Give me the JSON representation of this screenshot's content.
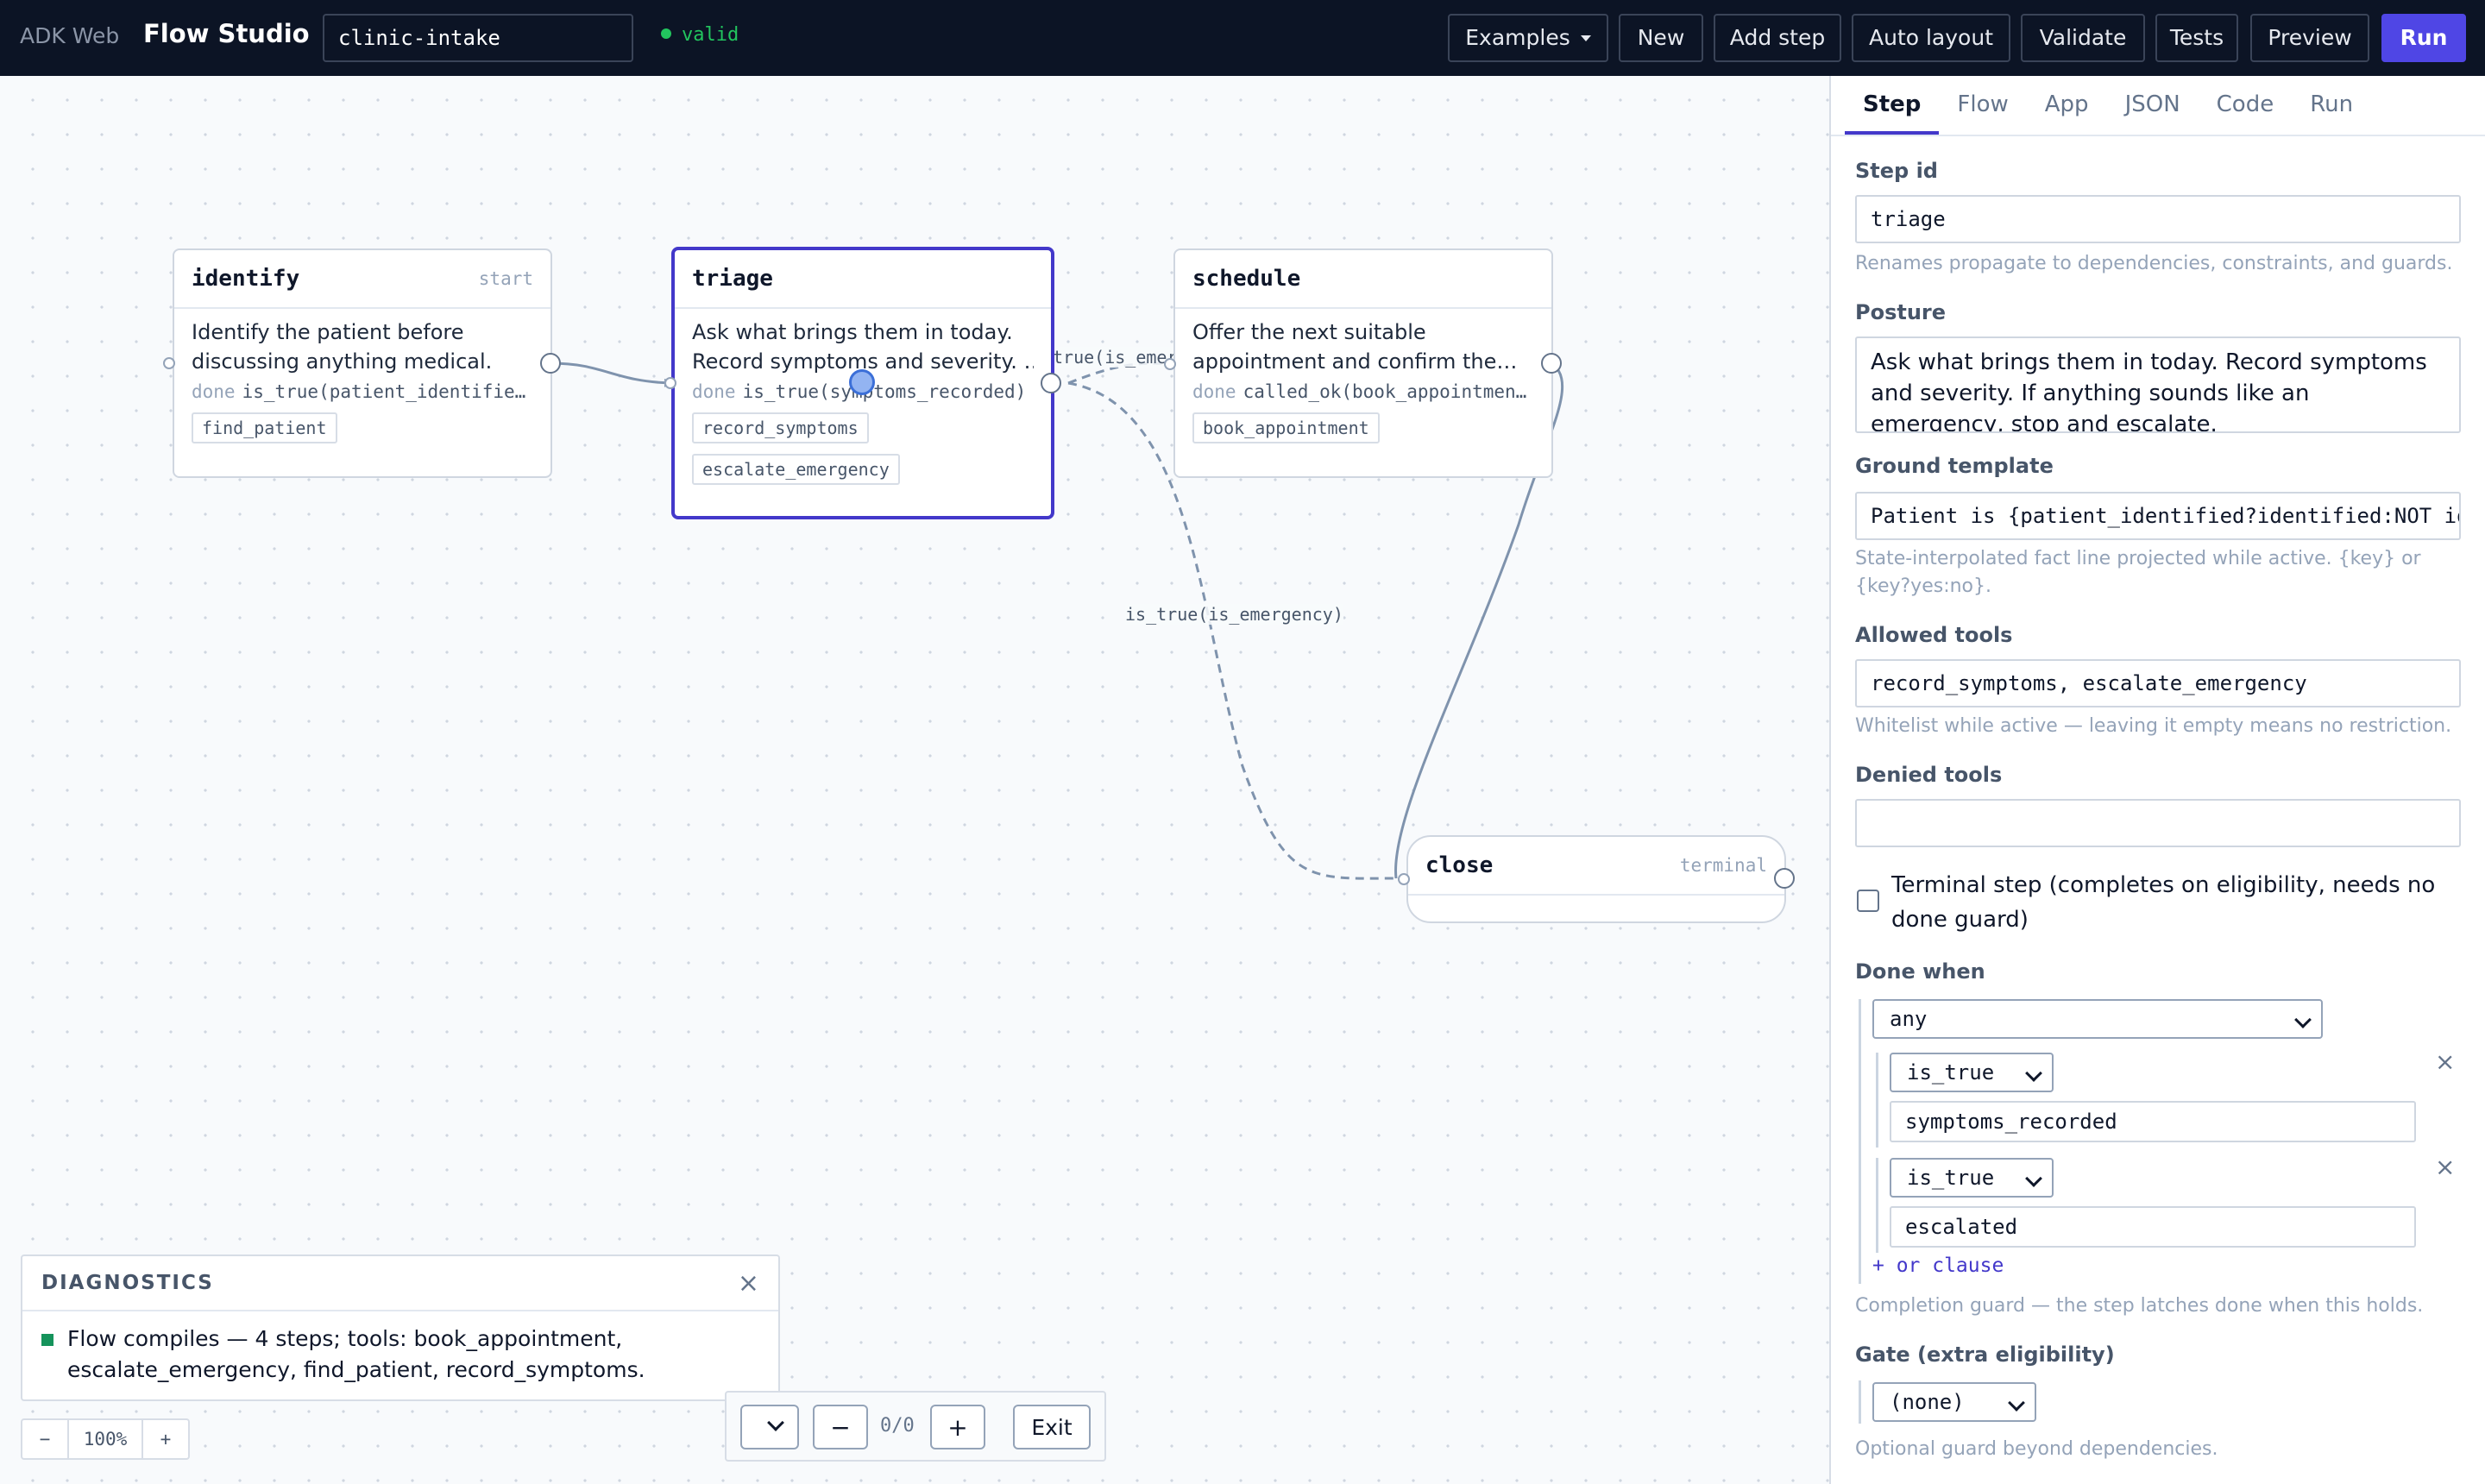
{
  "topbar": {
    "brand_dim": "ADK Web",
    "brand": "Flow Studio",
    "flow_name": "clinic-intake",
    "status": "valid",
    "buttons": {
      "examples": "Examples",
      "new": "New",
      "add_step": "Add step",
      "auto_layout": "Auto layout",
      "validate": "Validate",
      "tests": "Tests",
      "preview": "Preview",
      "run": "Run"
    }
  },
  "canvas": {
    "nodes": {
      "identify": {
        "title": "identify",
        "tag": "start",
        "desc_line1": "Identify the patient before",
        "desc_line2": "discussing anything medical.",
        "done_kw": "done",
        "done_expr": "is_true(patient_identified)",
        "tools": [
          "find_patient"
        ]
      },
      "triage": {
        "title": "triage",
        "desc_line1": "Ask what brings them in today.",
        "desc_line2": "Record symptoms and severity. …",
        "done_kw": "done",
        "done_expr": "is_true(symptoms_recorded)",
        "tools": [
          "record_symptoms",
          "escalate_emergency"
        ]
      },
      "schedule": {
        "title": "schedule",
        "desc_line1": "Offer the next suitable",
        "desc_line2": "appointment and confirm the…",
        "done_kw": "done",
        "done_expr": "called_ok(book_appointment)",
        "tools": [
          "book_appointment"
        ]
      },
      "close": {
        "title": "close",
        "tag": "terminal"
      }
    },
    "edge_labels": {
      "triage_schedule": "true(is_emerg",
      "triage_close": "is_true(is_emergency)"
    }
  },
  "diagnostics": {
    "title": "DIAGNOSTICS",
    "close": "×",
    "message_line1": "Flow compiles — 4 steps; tools: book_appointment,",
    "message_line2": "escalate_emergency, find_patient, record_symptoms.",
    "status_color": "#15935b"
  },
  "zoom": {
    "minus": "−",
    "value": "100%",
    "plus": "+"
  },
  "search": {
    "prev": "−",
    "count": "0/0",
    "next": "+",
    "exit": "Exit"
  },
  "panel": {
    "tabs": [
      "Step",
      "Flow",
      "App",
      "JSON",
      "Code",
      "Run"
    ],
    "active_tab": "Step",
    "step_id_label": "Step id",
    "step_id_value": "triage",
    "step_id_hint": "Renames propagate to dependencies, constraints, and guards.",
    "posture_label": "Posture",
    "posture_value": "Ask what brings them in today. Record symptoms and severity. If anything sounds like an emergency, stop and escalate.",
    "ground_label": "Ground template",
    "ground_value": "Patient is {patient_identified?identified:NOT identified}",
    "ground_hint": "State-interpolated fact line projected while active. {key} or {key?yes:no}.",
    "allowed_label": "Allowed tools",
    "allowed_value": "record_symptoms, escalate_emergency",
    "allowed_hint": "Whitelist while active — leaving it empty means no restriction.",
    "denied_label": "Denied tools",
    "denied_value": "",
    "terminal_checkbox_label": "Terminal step (completes on eligibility, needs no done guard)",
    "terminal_checked": false,
    "done_when_label": "Done when",
    "done_when_mode": "any",
    "clauses": [
      {
        "op": "is_true",
        "arg": "symptoms_recorded",
        "remove": "×"
      },
      {
        "op": "is_true",
        "arg": "escalated",
        "remove": "×"
      }
    ],
    "or_clause": "+ or clause",
    "done_hint": "Completion guard — the step latches done when this holds.",
    "gate_label": "Gate (extra eligibility)",
    "gate_value": "(none)",
    "gate_hint": "Optional guard beyond dependencies."
  },
  "colors": {
    "accent": "#4338ca",
    "run_button": "#4f46e5",
    "topbar": "#0c1425",
    "valid": "#22c55e"
  }
}
